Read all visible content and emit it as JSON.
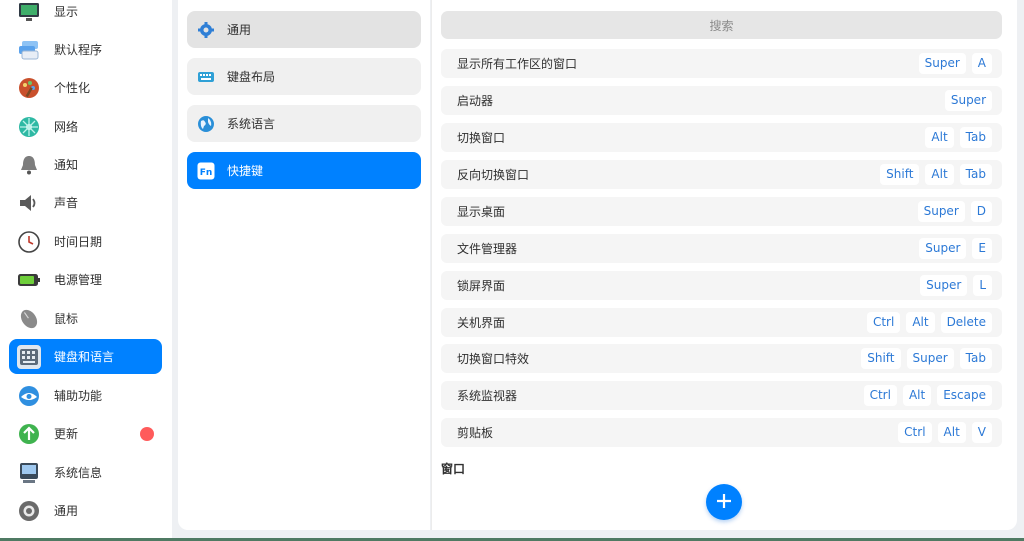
{
  "sidebar": {
    "items": [
      {
        "label": "显示",
        "icon": "monitor-icon"
      },
      {
        "label": "默认程序",
        "icon": "default-apps-icon"
      },
      {
        "label": "个性化",
        "icon": "palette-icon"
      },
      {
        "label": "网络",
        "icon": "network-icon"
      },
      {
        "label": "通知",
        "icon": "bell-icon"
      },
      {
        "label": "声音",
        "icon": "speaker-icon"
      },
      {
        "label": "时间日期",
        "icon": "clock-icon"
      },
      {
        "label": "电源管理",
        "icon": "battery-icon"
      },
      {
        "label": "鼠标",
        "icon": "mouse-icon"
      },
      {
        "label": "键盘和语言",
        "icon": "keyboard-icon",
        "active": true
      },
      {
        "label": "辅助功能",
        "icon": "accessibility-icon"
      },
      {
        "label": "更新",
        "icon": "update-icon",
        "badge": true
      },
      {
        "label": "系统信息",
        "icon": "system-info-icon"
      },
      {
        "label": "通用",
        "icon": "general-icon"
      }
    ]
  },
  "subnav": {
    "items": [
      {
        "label": "通用",
        "icon": "gear-icon",
        "state": "selected"
      },
      {
        "label": "键盘布局",
        "icon": "keyboard-layout-icon"
      },
      {
        "label": "系统语言",
        "icon": "globe-icon"
      },
      {
        "label": "快捷键",
        "icon": "fn-key-icon",
        "state": "active"
      }
    ]
  },
  "content": {
    "search_placeholder": "搜索",
    "shortcuts": [
      {
        "name": "显示所有工作区的窗口",
        "keys": [
          "Super",
          "A"
        ]
      },
      {
        "name": "启动器",
        "keys": [
          "Super"
        ]
      },
      {
        "name": "切换窗口",
        "keys": [
          "Alt",
          "Tab"
        ]
      },
      {
        "name": "反向切换窗口",
        "keys": [
          "Shift",
          "Alt",
          "Tab"
        ]
      },
      {
        "name": "显示桌面",
        "keys": [
          "Super",
          "D"
        ]
      },
      {
        "name": "文件管理器",
        "keys": [
          "Super",
          "E"
        ]
      },
      {
        "name": "锁屏界面",
        "keys": [
          "Super",
          "L"
        ]
      },
      {
        "name": "关机界面",
        "keys": [
          "Ctrl",
          "Alt",
          "Delete"
        ]
      },
      {
        "name": "切换窗口特效",
        "keys": [
          "Shift",
          "Super",
          "Tab"
        ]
      },
      {
        "name": "系统监视器",
        "keys": [
          "Ctrl",
          "Alt",
          "Escape"
        ]
      },
      {
        "name": "剪贴板",
        "keys": [
          "Ctrl",
          "Alt",
          "V"
        ]
      }
    ],
    "section_title": "窗口"
  },
  "colors": {
    "accent": "#0081ff",
    "key_text": "#2c79d6",
    "badge": "#ff5b5b"
  }
}
